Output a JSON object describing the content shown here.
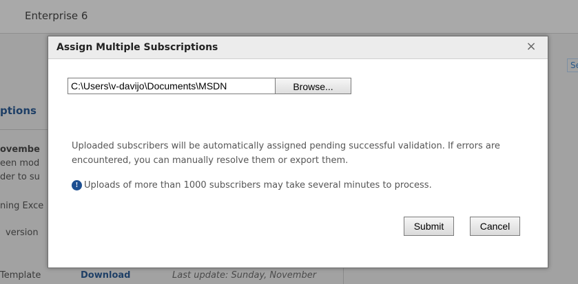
{
  "background": {
    "header_title": "Enterprise 6",
    "search_label": "Sear",
    "section_title": "ptions",
    "items": [
      "ovembe",
      "een mod",
      "der to su",
      "ning Exce",
      "version"
    ],
    "footer_row": {
      "template_label": "Template",
      "download_link": "Download",
      "last_update": "Last update: Sunday, November"
    }
  },
  "dialog": {
    "title": "Assign Multiple Subscriptions",
    "close_glyph": "×",
    "file_path_value": "C:\\Users\\v-davijo\\Documents\\MSDN",
    "browse_label": "Browse...",
    "info_text": "Uploaded subscribers will be automatically assigned pending successful validation. If errors are encountered, you can manually resolve them or export them.",
    "note_icon": "info-icon",
    "note_glyph": "!",
    "note_text": "Uploads of more than 1000 subscribers may take several minutes to process.",
    "submit_label": "Submit",
    "cancel_label": "Cancel"
  }
}
